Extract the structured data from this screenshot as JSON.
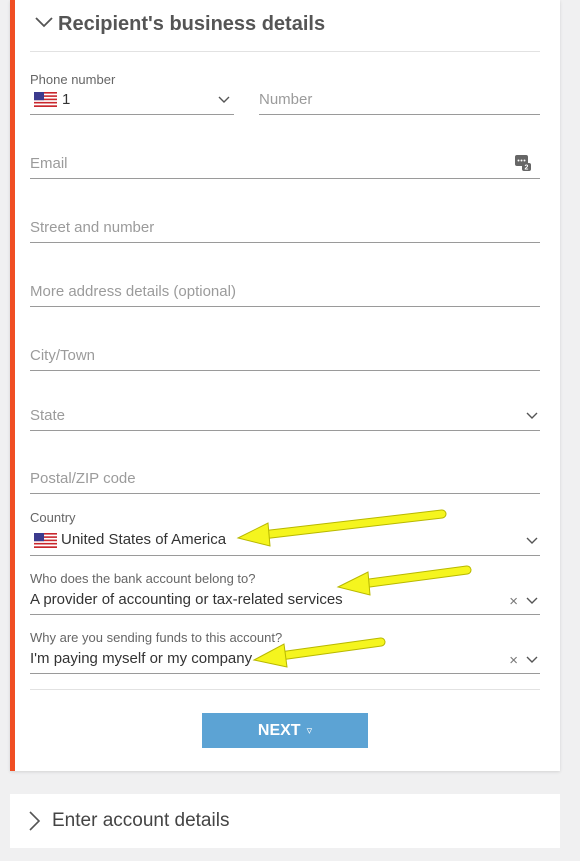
{
  "section": {
    "title": "Recipient's business details",
    "icon": "chevron-down-icon"
  },
  "phone": {
    "label": "Phone number",
    "country_code": "1",
    "flag": "us-flag-icon",
    "number_placeholder": "Number"
  },
  "email": {
    "placeholder": "Email",
    "icon": "contact-card-icon"
  },
  "street": {
    "placeholder": "Street and number"
  },
  "address_more": {
    "placeholder": "More address details (optional)"
  },
  "city": {
    "placeholder": "City/Town"
  },
  "state": {
    "placeholder": "State"
  },
  "postal": {
    "placeholder": "Postal/ZIP code"
  },
  "country": {
    "label": "Country",
    "value": "United States of America",
    "flag": "us-flag-icon"
  },
  "account_owner": {
    "label": "Who does the bank account belong to?",
    "value": "A provider of accounting or tax-related services"
  },
  "purpose": {
    "label": "Why are you sending funds to this account?",
    "value": "I'm paying myself or my company"
  },
  "next_button": {
    "label": "NEXT",
    "icon": "▿"
  },
  "next_section": {
    "title": "Enter account details",
    "icon": "chevron-right-icon"
  },
  "colors": {
    "accent": "#f04e23",
    "button": "#5ca3d4",
    "annotation_arrow": "#f5f51e"
  }
}
